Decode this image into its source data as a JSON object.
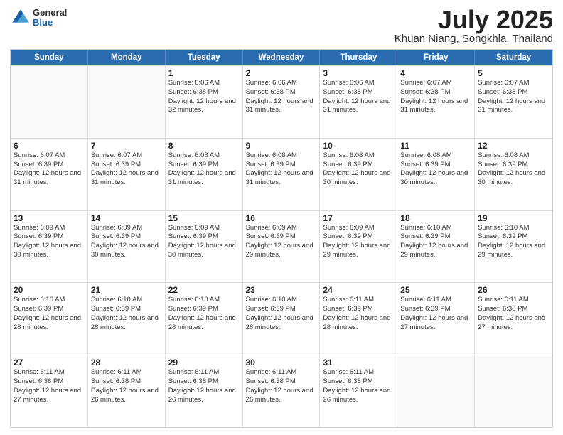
{
  "header": {
    "logo_general": "General",
    "logo_blue": "Blue",
    "title": "July 2025",
    "location": "Khuan Niang, Songkhla, Thailand"
  },
  "weekdays": [
    "Sunday",
    "Monday",
    "Tuesday",
    "Wednesday",
    "Thursday",
    "Friday",
    "Saturday"
  ],
  "weeks": [
    [
      {
        "day": "",
        "info": ""
      },
      {
        "day": "",
        "info": ""
      },
      {
        "day": "1",
        "info": "Sunrise: 6:06 AM\nSunset: 6:38 PM\nDaylight: 12 hours and 32 minutes."
      },
      {
        "day": "2",
        "info": "Sunrise: 6:06 AM\nSunset: 6:38 PM\nDaylight: 12 hours and 31 minutes."
      },
      {
        "day": "3",
        "info": "Sunrise: 6:06 AM\nSunset: 6:38 PM\nDaylight: 12 hours and 31 minutes."
      },
      {
        "day": "4",
        "info": "Sunrise: 6:07 AM\nSunset: 6:38 PM\nDaylight: 12 hours and 31 minutes."
      },
      {
        "day": "5",
        "info": "Sunrise: 6:07 AM\nSunset: 6:38 PM\nDaylight: 12 hours and 31 minutes."
      }
    ],
    [
      {
        "day": "6",
        "info": "Sunrise: 6:07 AM\nSunset: 6:39 PM\nDaylight: 12 hours and 31 minutes."
      },
      {
        "day": "7",
        "info": "Sunrise: 6:07 AM\nSunset: 6:39 PM\nDaylight: 12 hours and 31 minutes."
      },
      {
        "day": "8",
        "info": "Sunrise: 6:08 AM\nSunset: 6:39 PM\nDaylight: 12 hours and 31 minutes."
      },
      {
        "day": "9",
        "info": "Sunrise: 6:08 AM\nSunset: 6:39 PM\nDaylight: 12 hours and 31 minutes."
      },
      {
        "day": "10",
        "info": "Sunrise: 6:08 AM\nSunset: 6:39 PM\nDaylight: 12 hours and 30 minutes."
      },
      {
        "day": "11",
        "info": "Sunrise: 6:08 AM\nSunset: 6:39 PM\nDaylight: 12 hours and 30 minutes."
      },
      {
        "day": "12",
        "info": "Sunrise: 6:08 AM\nSunset: 6:39 PM\nDaylight: 12 hours and 30 minutes."
      }
    ],
    [
      {
        "day": "13",
        "info": "Sunrise: 6:09 AM\nSunset: 6:39 PM\nDaylight: 12 hours and 30 minutes."
      },
      {
        "day": "14",
        "info": "Sunrise: 6:09 AM\nSunset: 6:39 PM\nDaylight: 12 hours and 30 minutes."
      },
      {
        "day": "15",
        "info": "Sunrise: 6:09 AM\nSunset: 6:39 PM\nDaylight: 12 hours and 30 minutes."
      },
      {
        "day": "16",
        "info": "Sunrise: 6:09 AM\nSunset: 6:39 PM\nDaylight: 12 hours and 29 minutes."
      },
      {
        "day": "17",
        "info": "Sunrise: 6:09 AM\nSunset: 6:39 PM\nDaylight: 12 hours and 29 minutes."
      },
      {
        "day": "18",
        "info": "Sunrise: 6:10 AM\nSunset: 6:39 PM\nDaylight: 12 hours and 29 minutes."
      },
      {
        "day": "19",
        "info": "Sunrise: 6:10 AM\nSunset: 6:39 PM\nDaylight: 12 hours and 29 minutes."
      }
    ],
    [
      {
        "day": "20",
        "info": "Sunrise: 6:10 AM\nSunset: 6:39 PM\nDaylight: 12 hours and 28 minutes."
      },
      {
        "day": "21",
        "info": "Sunrise: 6:10 AM\nSunset: 6:39 PM\nDaylight: 12 hours and 28 minutes."
      },
      {
        "day": "22",
        "info": "Sunrise: 6:10 AM\nSunset: 6:39 PM\nDaylight: 12 hours and 28 minutes."
      },
      {
        "day": "23",
        "info": "Sunrise: 6:10 AM\nSunset: 6:39 PM\nDaylight: 12 hours and 28 minutes."
      },
      {
        "day": "24",
        "info": "Sunrise: 6:11 AM\nSunset: 6:39 PM\nDaylight: 12 hours and 28 minutes."
      },
      {
        "day": "25",
        "info": "Sunrise: 6:11 AM\nSunset: 6:39 PM\nDaylight: 12 hours and 27 minutes."
      },
      {
        "day": "26",
        "info": "Sunrise: 6:11 AM\nSunset: 6:38 PM\nDaylight: 12 hours and 27 minutes."
      }
    ],
    [
      {
        "day": "27",
        "info": "Sunrise: 6:11 AM\nSunset: 6:38 PM\nDaylight: 12 hours and 27 minutes."
      },
      {
        "day": "28",
        "info": "Sunrise: 6:11 AM\nSunset: 6:38 PM\nDaylight: 12 hours and 26 minutes."
      },
      {
        "day": "29",
        "info": "Sunrise: 6:11 AM\nSunset: 6:38 PM\nDaylight: 12 hours and 26 minutes."
      },
      {
        "day": "30",
        "info": "Sunrise: 6:11 AM\nSunset: 6:38 PM\nDaylight: 12 hours and 26 minutes."
      },
      {
        "day": "31",
        "info": "Sunrise: 6:11 AM\nSunset: 6:38 PM\nDaylight: 12 hours and 26 minutes."
      },
      {
        "day": "",
        "info": ""
      },
      {
        "day": "",
        "info": ""
      }
    ]
  ]
}
